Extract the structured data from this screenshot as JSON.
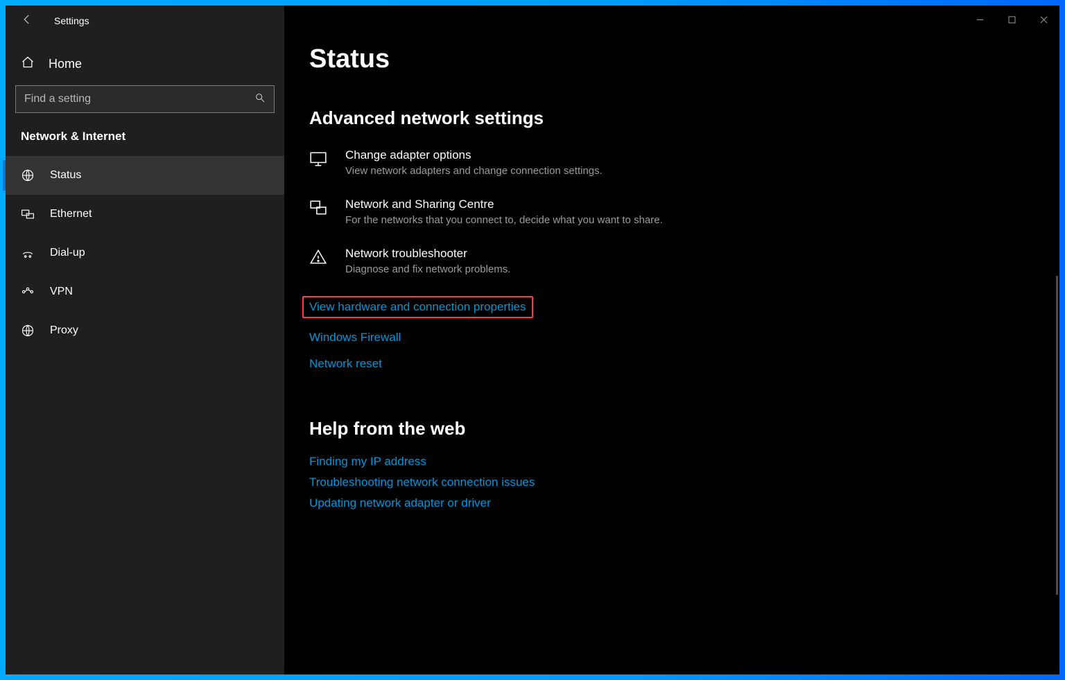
{
  "window": {
    "app_title": "Settings"
  },
  "sidebar": {
    "home_label": "Home",
    "search_placeholder": "Find a setting",
    "category": "Network & Internet",
    "items": [
      {
        "label": "Status",
        "icon": "globe",
        "active": true
      },
      {
        "label": "Ethernet",
        "icon": "ethernet",
        "active": false
      },
      {
        "label": "Dial-up",
        "icon": "dialup",
        "active": false
      },
      {
        "label": "VPN",
        "icon": "vpn",
        "active": false
      },
      {
        "label": "Proxy",
        "icon": "globe",
        "active": false
      }
    ]
  },
  "main": {
    "page_title": "Status",
    "advanced": {
      "heading": "Advanced network settings",
      "items": [
        {
          "title": "Change adapter options",
          "desc": "View network adapters and change connection settings."
        },
        {
          "title": "Network and Sharing Centre",
          "desc": "For the networks that you connect to, decide what you want to share."
        },
        {
          "title": "Network troubleshooter",
          "desc": "Diagnose and fix network problems."
        }
      ],
      "links": [
        {
          "label": "View hardware and connection properties",
          "highlight": true
        },
        {
          "label": "Windows Firewall",
          "highlight": false
        },
        {
          "label": "Network reset",
          "highlight": false
        }
      ]
    },
    "help": {
      "heading": "Help from the web",
      "links": [
        "Finding my IP address",
        "Troubleshooting network connection issues",
        "Updating network adapter or driver"
      ]
    }
  },
  "colors": {
    "accent": "#0096db",
    "highlight_border": "#ff3b3b"
  }
}
